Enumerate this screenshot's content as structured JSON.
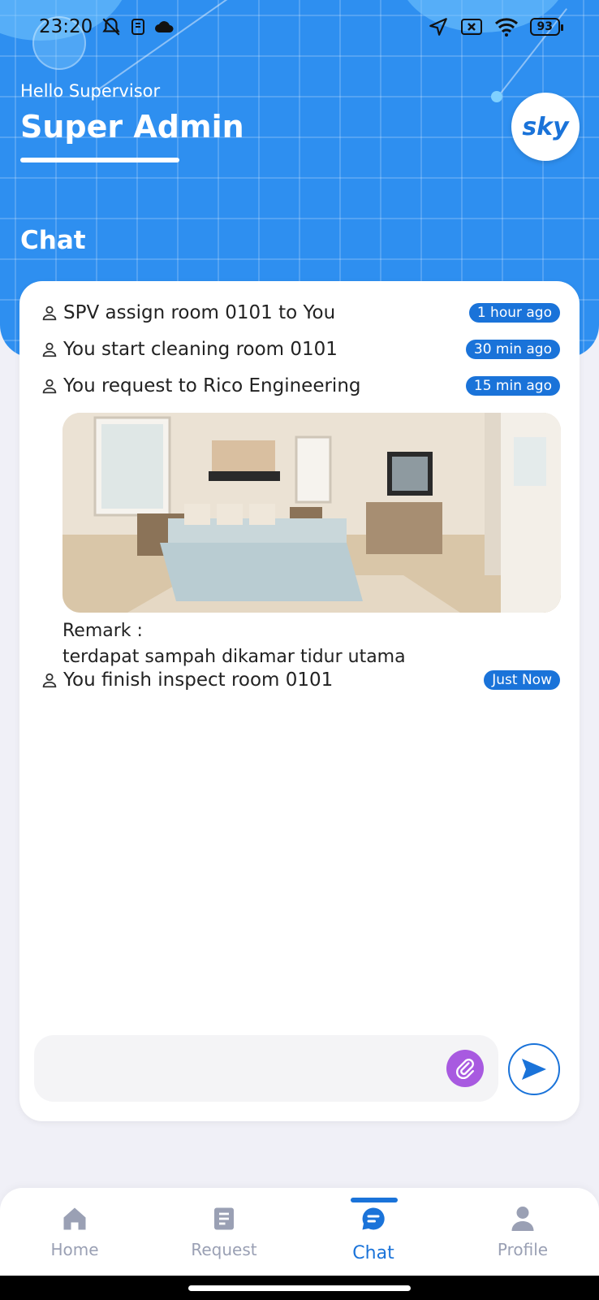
{
  "status_bar": {
    "time": "23:20",
    "battery": "93"
  },
  "header": {
    "greeting": "Hello Supervisor",
    "username": "Super Admin",
    "logo_text": "sky",
    "section_title": "Chat"
  },
  "chat": {
    "messages": [
      {
        "text": "SPV assign room 0101 to You",
        "time": "1 hour ago"
      },
      {
        "text": "You start cleaning room 0101",
        "time": "30 min ago"
      },
      {
        "text": "You request to Rico Engineering",
        "time": "15 min ago"
      },
      {
        "text": "You finish inspect room 0101",
        "time": "Just Now"
      }
    ],
    "remark_label": "Remark :",
    "remark_text": "terdapat sampah dikamar tidur utama",
    "input_placeholder": ""
  },
  "nav": {
    "items": [
      {
        "label": "Home",
        "icon": "home-icon"
      },
      {
        "label": "Request",
        "icon": "document-icon"
      },
      {
        "label": "Chat",
        "icon": "chat-icon"
      },
      {
        "label": "Profile",
        "icon": "person-icon"
      }
    ],
    "active": "Chat"
  },
  "colors": {
    "primary": "#1a73d9",
    "header_bg": "#2e8ff0",
    "attach": "#a85ae0",
    "nav_inactive": "#9aa0b4"
  }
}
